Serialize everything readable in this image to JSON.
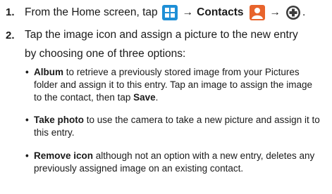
{
  "steps": [
    {
      "number": "1.",
      "text_a": "From the Home screen, tap",
      "arrow1": "→",
      "contacts_label": "Contacts",
      "arrow2": "→",
      "end": ".",
      "icons": [
        "apps-grid-icon",
        "contacts-app-icon",
        "add-plus-icon"
      ]
    },
    {
      "number": "2.",
      "line1": "Tap the image icon and assign a picture to the new entry",
      "line2": "by choosing one of three options:"
    }
  ],
  "options": [
    {
      "term": "Album",
      "line1_rest": " to retrieve a previously stored image from your Pictures",
      "line2_a": "folder and assign it to this entry. Tap an image to assign the image",
      "line3_a": "to the contact, then tap ",
      "line3_b": "Save",
      "line3_c": "."
    },
    {
      "term": "Take photo",
      "line1_rest": " to use the camera to take a new picture and assign it to",
      "line2_a": "this entry."
    },
    {
      "term": "Remove icon",
      "line1_rest": " although not an option with a new entry, deletes any",
      "line2_a": "previously assigned image on an existing contact."
    }
  ],
  "colors": {
    "apps_icon": "#1e8fd6",
    "contacts_icon": "#e8642c",
    "plus_icon": "#3b3b3b"
  }
}
